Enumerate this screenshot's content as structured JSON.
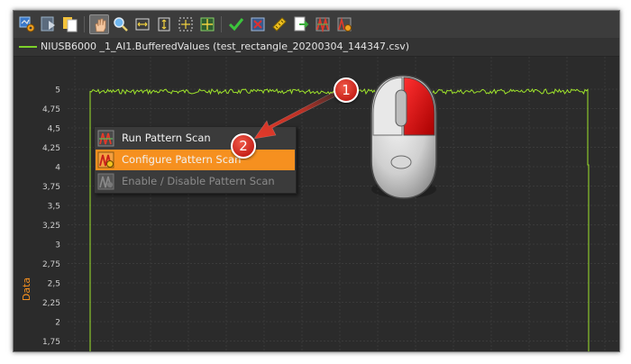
{
  "toolbar": {
    "buttons": [
      {
        "name": "settings-icon"
      },
      {
        "name": "play-icon"
      },
      {
        "name": "copy-icon"
      },
      {
        "name": "pan-hand-icon",
        "active": true
      },
      {
        "name": "zoom-icon"
      },
      {
        "name": "zoom-horizontal-icon"
      },
      {
        "name": "zoom-vertical-icon"
      },
      {
        "name": "zoom-fit-icon"
      },
      {
        "name": "zoom-center-icon"
      },
      {
        "name": "check-icon"
      },
      {
        "name": "clear-icon"
      },
      {
        "name": "ruler-icon"
      },
      {
        "name": "export-icon"
      },
      {
        "name": "pattern-scan-icon"
      },
      {
        "name": "pattern-settings-icon"
      }
    ]
  },
  "legend": {
    "text": "NIUSB6000 _1_AI1.BufferedValues (test_rectangle_20200304_144347.csv)",
    "color": "#7cd12a"
  },
  "chart_data": {
    "type": "line",
    "ylabel": "Data",
    "xlabel": "",
    "yticks": [
      "5",
      "4,75",
      "4,5",
      "4,25",
      "4",
      "3,75",
      "3,5",
      "3,25",
      "3",
      "2,75",
      "2,5",
      "2,25",
      "2",
      "1,75"
    ],
    "ylim": [
      1.65,
      5.1
    ],
    "grid": true,
    "series": [
      {
        "description": "rectangular pulse",
        "baseline": 1.65,
        "high": 4.97,
        "noise": 0.03,
        "color": "#9ee32b"
      }
    ]
  },
  "context_menu": {
    "items": [
      {
        "label": "Run Pattern Scan",
        "icon": "run-pattern-scan-icon",
        "state": "normal"
      },
      {
        "label": "Configure Pattern Scan",
        "icon": "configure-pattern-scan-icon",
        "state": "highlighted"
      },
      {
        "label": "Enable / Disable Pattern Scan",
        "icon": "enable-disable-pattern-scan-icon",
        "state": "disabled"
      }
    ]
  },
  "annotations": {
    "badge_1": "1",
    "badge_2": "2",
    "mouse_button": "right-click"
  },
  "colors": {
    "background": "#2b2b2b",
    "accent": "#f6901f",
    "axis_label": "#f6901f",
    "signal": "#9ee32b",
    "badge": "#d02a20"
  }
}
